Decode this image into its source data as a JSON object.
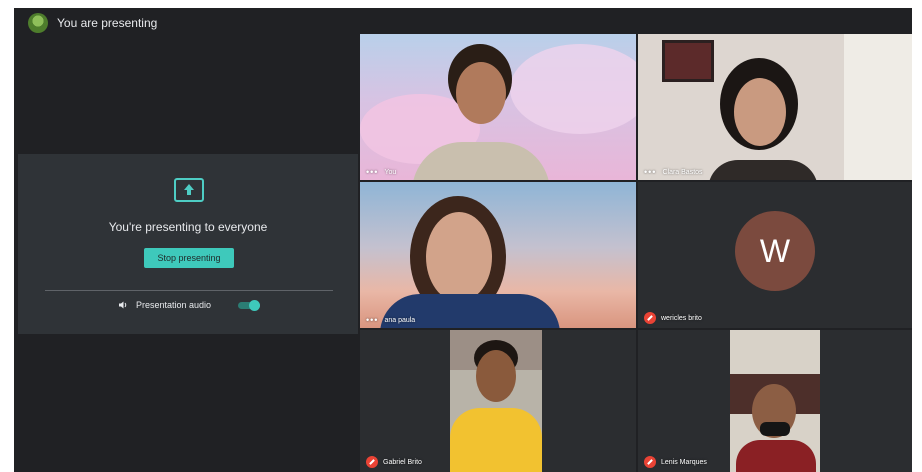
{
  "header": {
    "title": "You are presenting"
  },
  "presentation": {
    "message": "You're presenting to everyone",
    "stop_label": "Stop presenting",
    "audio_label": "Presentation audio",
    "audio_enabled": true
  },
  "participants": [
    {
      "name": "You",
      "tile": "video"
    },
    {
      "name": "Clara Bastos",
      "tile": "video"
    },
    {
      "name": "ana paula",
      "tile": "video"
    },
    {
      "name": "wericles brito",
      "tile": "avatar",
      "initial": "W",
      "avatar_color": "#7b4a3e",
      "muted": true
    },
    {
      "name": "Gabriel Brito",
      "tile": "video",
      "muted": true
    },
    {
      "name": "Lenis Marques",
      "tile": "video",
      "muted": true
    }
  ],
  "colors": {
    "accent": "#3ec9bb",
    "background": "#202124",
    "muted": "#ea4335"
  }
}
